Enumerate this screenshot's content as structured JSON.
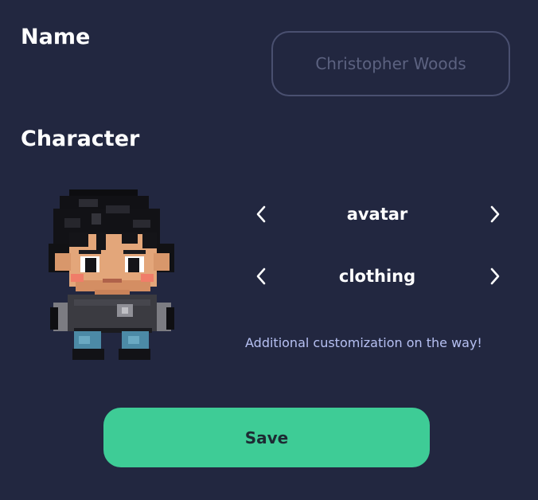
{
  "form": {
    "name_label": "Name",
    "name_placeholder": "Christopher Woods",
    "name_value": "",
    "character_label": "Character"
  },
  "character": {
    "avatar_label": "avatar",
    "clothing_label": "clothing",
    "note": "Additional customization on the way!"
  },
  "actions": {
    "save_label": "Save"
  },
  "icons": {
    "prev": "chevron-left-icon",
    "next": "chevron-right-icon"
  },
  "colors": {
    "background": "#222740",
    "accent": "#3ecc96",
    "note_text": "#b6c0f2",
    "input_border": "#4a5070"
  }
}
